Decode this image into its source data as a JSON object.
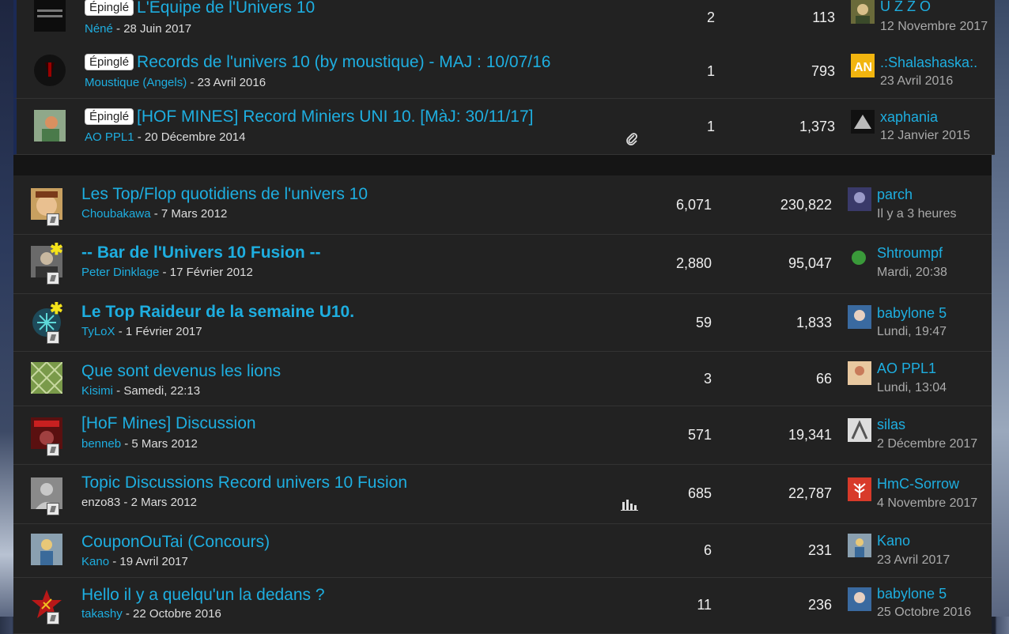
{
  "sticky_label": "Épinglé",
  "sticky_topics": [
    {
      "title": "L'Equipe de l'Univers 10",
      "author": "Néné",
      "date": "28 Juin 2017",
      "replies": "2",
      "views": "113",
      "last_user": "U Z Z O",
      "last_date": "12 Novembre 2017"
    },
    {
      "title": "Records de l'univers 10 (by moustique) - MAJ : 10/07/16",
      "author": "Moustique (Angels)",
      "date": "23 Avril 2016",
      "replies": "1",
      "views": "793",
      "last_user": ".:Shalashaska:.",
      "last_date": "23 Avril 2016"
    },
    {
      "title": "[HOF MINES] Record Miniers UNI 10. [MàJ: 30/11/17]",
      "author": "AO PPL1",
      "date": "20 Décembre 2014",
      "replies": "1",
      "views": "1,373",
      "last_user": "xaphania",
      "last_date": "12 Janvier 2015",
      "attachment": "paperclip-icon"
    }
  ],
  "topics": [
    {
      "title": "Les Top/Flop quotidiens de l'univers 10",
      "author": "Choubakawa",
      "date": "7 Mars 2012",
      "replies": "6,071",
      "views": "230,822",
      "last_user": "parch",
      "last_date": "Il y a 3 heures"
    },
    {
      "title": "-- Bar de l'Univers 10 Fusion --",
      "author": "Peter Dinklage",
      "date": "17 Février 2012",
      "replies": "2,880",
      "views": "95,047",
      "last_user": "Shtroumpf",
      "last_date": "Mardi, 20:38",
      "unread": true
    },
    {
      "title": "Le Top Raideur de la semaine U10.",
      "author": "TyLoX",
      "date": "1 Février 2017",
      "replies": "59",
      "views": "1,833",
      "last_user": "babylone 5",
      "last_date": "Lundi, 19:47",
      "unread": true
    },
    {
      "title": "Que sont devenus les lions",
      "author": "Kisimi",
      "date": "Samedi, 22:13",
      "replies": "3",
      "views": "66",
      "last_user": "AO PPL1",
      "last_date": "Lundi, 13:04"
    },
    {
      "title": "[HoF Mines] Discussion",
      "author": "benneb",
      "date": "5 Mars 2012",
      "replies": "571",
      "views": "19,341",
      "last_user": "silas",
      "last_date": "2 Décembre 2017"
    },
    {
      "title": "Topic Discussions Record univers 10 Fusion",
      "author": "enzo83",
      "date": "2 Mars 2012",
      "replies": "685",
      "views": "22,787",
      "last_user": "HmC-Sorrow",
      "last_date": "4 Novembre 2017",
      "poll": "bar-chart-icon"
    },
    {
      "title": "CouponOuTai (Concours)",
      "author": "Kano",
      "date": "19 Avril 2017",
      "replies": "6",
      "views": "231",
      "last_user": "Kano",
      "last_date": "23 Avril 2017"
    },
    {
      "title": "Hello il y a quelqu'un la dedans ?",
      "author": "takashy",
      "date": "22 Octobre 2016",
      "replies": "11",
      "views": "236",
      "last_user": "babylone 5",
      "last_date": "25 Octobre 2016"
    }
  ]
}
